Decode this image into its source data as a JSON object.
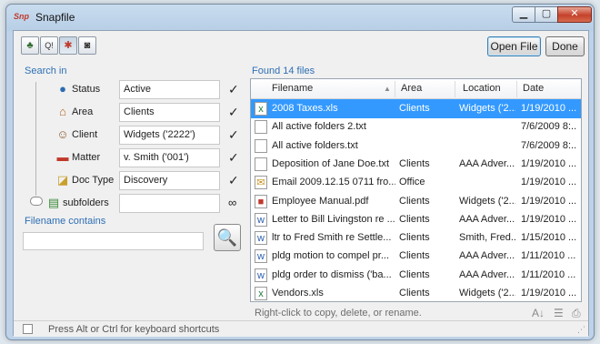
{
  "window": {
    "title": "Snapfile",
    "app_icon": "Snp"
  },
  "window_controls": {
    "minimize": "▁",
    "maximize": "▢",
    "close": "✕"
  },
  "toolbar": {
    "tools": [
      {
        "icon": "leaf-icon",
        "glyph": "♣"
      },
      {
        "icon": "search-question-icon",
        "glyph": "Q!"
      },
      {
        "icon": "network-icon",
        "glyph": "✱"
      },
      {
        "icon": "camera-icon",
        "glyph": "◙"
      }
    ],
    "open_file_label": "Open File",
    "done_label": "Done"
  },
  "search_in": {
    "label": "Search in",
    "rows": [
      {
        "icon": "globe-icon",
        "glyph": "●",
        "label": "Status",
        "value": "Active",
        "check": "✓"
      },
      {
        "icon": "house-icon",
        "glyph": "⌂",
        "label": "Area",
        "value": "Clients",
        "check": "✓"
      },
      {
        "icon": "person-icon",
        "glyph": "☺",
        "label": "Client",
        "value": "Widgets ('2222')",
        "check": "✓"
      },
      {
        "icon": "folder-red-icon",
        "glyph": "▬",
        "label": "Matter",
        "value": "v. Smith ('001')",
        "check": "✓"
      },
      {
        "icon": "doc-type-icon",
        "glyph": "◪",
        "label": "Doc Type",
        "value": "Discovery",
        "check": "✓"
      },
      {
        "icon": "subfolders-icon",
        "glyph": "▤",
        "label": "subfolders",
        "value": "",
        "check": "∞"
      }
    ]
  },
  "filename_contains": {
    "label": "Filename contains",
    "value": "",
    "search_glyph": "🔍"
  },
  "results": {
    "found_label": "Found 14 files",
    "columns": [
      "Filename",
      "Area",
      "Location",
      "Date"
    ],
    "sort_arrow": "▲",
    "rows": [
      {
        "icon": "excel-icon",
        "glyph": "x",
        "name": "2008 Taxes.xls",
        "area": "Clients",
        "location": "Widgets ('2...",
        "date": "1/19/2010 ...",
        "selected": true
      },
      {
        "icon": "text-file-icon",
        "glyph": "",
        "name": "All active folders 2.txt",
        "area": "",
        "location": "",
        "date": "7/6/2009 8:...",
        "selected": false
      },
      {
        "icon": "text-file-icon",
        "glyph": "",
        "name": "All active folders.txt",
        "area": "",
        "location": "",
        "date": "7/6/2009 8:...",
        "selected": false
      },
      {
        "icon": "text-file-icon",
        "glyph": "",
        "name": "Deposition of Jane Doe.txt",
        "area": "Clients",
        "location": "AAA Adver...",
        "date": "1/19/2010 ...",
        "selected": false
      },
      {
        "icon": "email-icon",
        "glyph": "✉",
        "name": "Email 2009.12.15 0711 fro...",
        "area": "Office",
        "location": "",
        "date": "1/19/2010 ...",
        "selected": false
      },
      {
        "icon": "pdf-icon",
        "glyph": "■",
        "name": "Employee Manual.pdf",
        "area": "Clients",
        "location": "Widgets ('2...",
        "date": "1/19/2010 ...",
        "selected": false
      },
      {
        "icon": "word-icon",
        "glyph": "w",
        "name": "Letter to Bill Livingston re ...",
        "area": "Clients",
        "location": "AAA Adver...",
        "date": "1/19/2010 ...",
        "selected": false
      },
      {
        "icon": "word-icon",
        "glyph": "w",
        "name": "ltr to Fred Smith re Settle...",
        "area": "Clients",
        "location": "Smith, Fred...",
        "date": "1/15/2010 ...",
        "selected": false
      },
      {
        "icon": "word-icon",
        "glyph": "w",
        "name": "pldg motion to compel pr...",
        "area": "Clients",
        "location": "AAA Adver...",
        "date": "1/11/2010 ...",
        "selected": false
      },
      {
        "icon": "word-icon",
        "glyph": "w",
        "name": "pldg order to dismiss ('ba...",
        "area": "Clients",
        "location": "AAA Adver...",
        "date": "1/11/2010 ...",
        "selected": false
      },
      {
        "icon": "excel-icon",
        "glyph": "x",
        "name": "Vendors.xls",
        "area": "Clients",
        "location": "Widgets ('2...",
        "date": "1/19/2010 ...",
        "selected": false
      }
    ],
    "hint": "Right-click to copy, delete, or rename.",
    "bottom_icons": [
      {
        "icon": "sort-az-icon",
        "glyph": "A↓"
      },
      {
        "icon": "columns-icon",
        "glyph": "☰"
      },
      {
        "icon": "print-icon",
        "glyph": "⎙"
      }
    ]
  },
  "status_bar": {
    "text": "Press Alt or Ctrl for keyboard shortcuts",
    "grip": "⋰"
  }
}
